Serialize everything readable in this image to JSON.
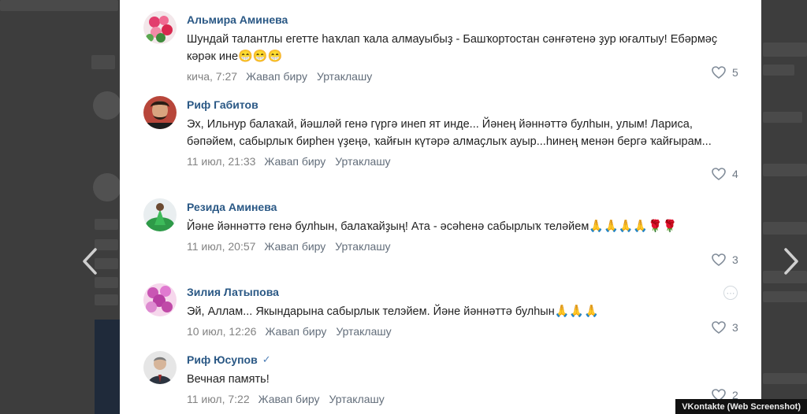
{
  "comments": [
    {
      "author": "Альмира Аминева",
      "text": "Шундай талантлы егетте һаҡлап ҡала алмауыбыҙ - Башҡортостан сәнғәтенә ҙур юғалтыу! Ебәрмәҫ кәрәк ине",
      "emoji": "😁😁😁",
      "date": "кича, 7:27",
      "reply": "Жавап биру",
      "share": "Уртаклашу",
      "likes": "5"
    },
    {
      "author": "Риф Габитов",
      "text": "Эх, Ильнур балаҡай, йәшләй генә гүргә инеп ят инде... Йәнең йәннәттә булһын, улым! Лариса, бәпәйем, сабырлыҡ бирһен үҙеңә, ҡайғын күтәрә алмаҫлыҡ ауыр...һинең менән бергә ҡайғырам...",
      "emoji": "",
      "date": "11 июл, 21:33",
      "reply": "Жавап биру",
      "share": "Уртаклашу",
      "likes": "4"
    },
    {
      "author": "Резида Аминева",
      "text": "Йәне йәннәттә генә булһын, балаҡайҙың! Ата - әсәһенә сабырлыҡ теләйем",
      "emoji": "🙏🙏🙏🙏🌹🌹",
      "date": "11 июл, 20:57",
      "reply": "Жавап биру",
      "share": "Уртаклашу",
      "likes": "3"
    },
    {
      "author": "Зилия Латыпова",
      "text": "Эй, Аллам... Якындарына сабырлык телэйем. Йәне йәннәттә булһын",
      "emoji": "🙏🙏🙏",
      "date": "10 июл, 12:26",
      "reply": "Жавап биру",
      "share": "Уртаклашу",
      "likes": "3"
    },
    {
      "author": "Риф Юсупов",
      "verified": "✓",
      "text": "Вечная память!",
      "emoji": "",
      "date": "11 июл, 7:22",
      "reply": "Жавап биру",
      "share": "Уртаклашу",
      "likes": "2"
    }
  ],
  "credit": "VKontakte (Web Screenshot)",
  "icons": {
    "like": "heart-icon",
    "nav_prev": "chevron-left-icon",
    "nav_next": "chevron-right-icon",
    "verified": "verified-check-icon"
  },
  "colors": {
    "author_link": "#2a5885",
    "meta_text": "#828282",
    "backdrop": "#3d3d3d"
  }
}
